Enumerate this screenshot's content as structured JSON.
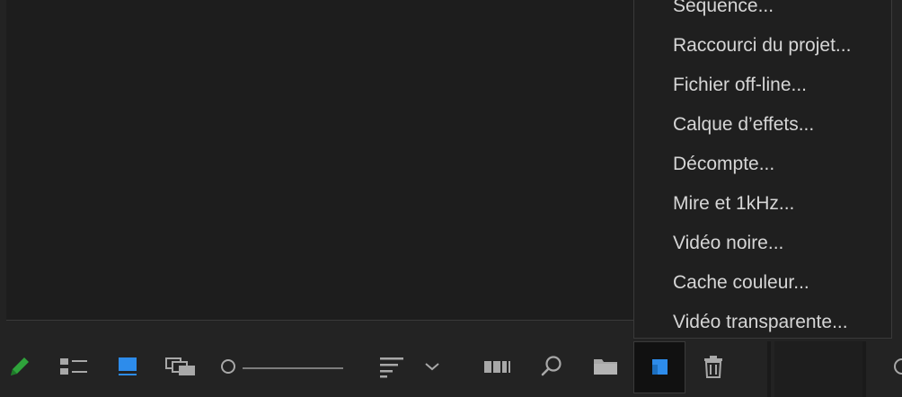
{
  "menu": {
    "items": [
      {
        "label": "Séquence..."
      },
      {
        "label": "Raccourci du projet..."
      },
      {
        "label": "Fichier off-line..."
      },
      {
        "label": "Calque d’effets..."
      },
      {
        "label": "Décompte..."
      },
      {
        "label": "Mire et 1kHz..."
      },
      {
        "label": "Vidéo noire..."
      },
      {
        "label": "Cache couleur..."
      },
      {
        "label": "Vidéo transparente..."
      }
    ]
  },
  "toolbar": {
    "icons": [
      "pencil-icon",
      "list-view-icon",
      "icon-view-icon",
      "freeform-view-icon",
      "zoom-slider",
      "sort-icon",
      "chevron-down-icon",
      "automate-to-sequence-icon",
      "find-icon",
      "new-bin-icon",
      "new-item-icon",
      "trash-icon"
    ],
    "zoom_level": 0.05
  },
  "colors": {
    "accent": "#2d8ceb",
    "pencil": "#2fa33b",
    "menu_text": "#d6d6d6",
    "panel_bg": "#1d1d1d"
  }
}
